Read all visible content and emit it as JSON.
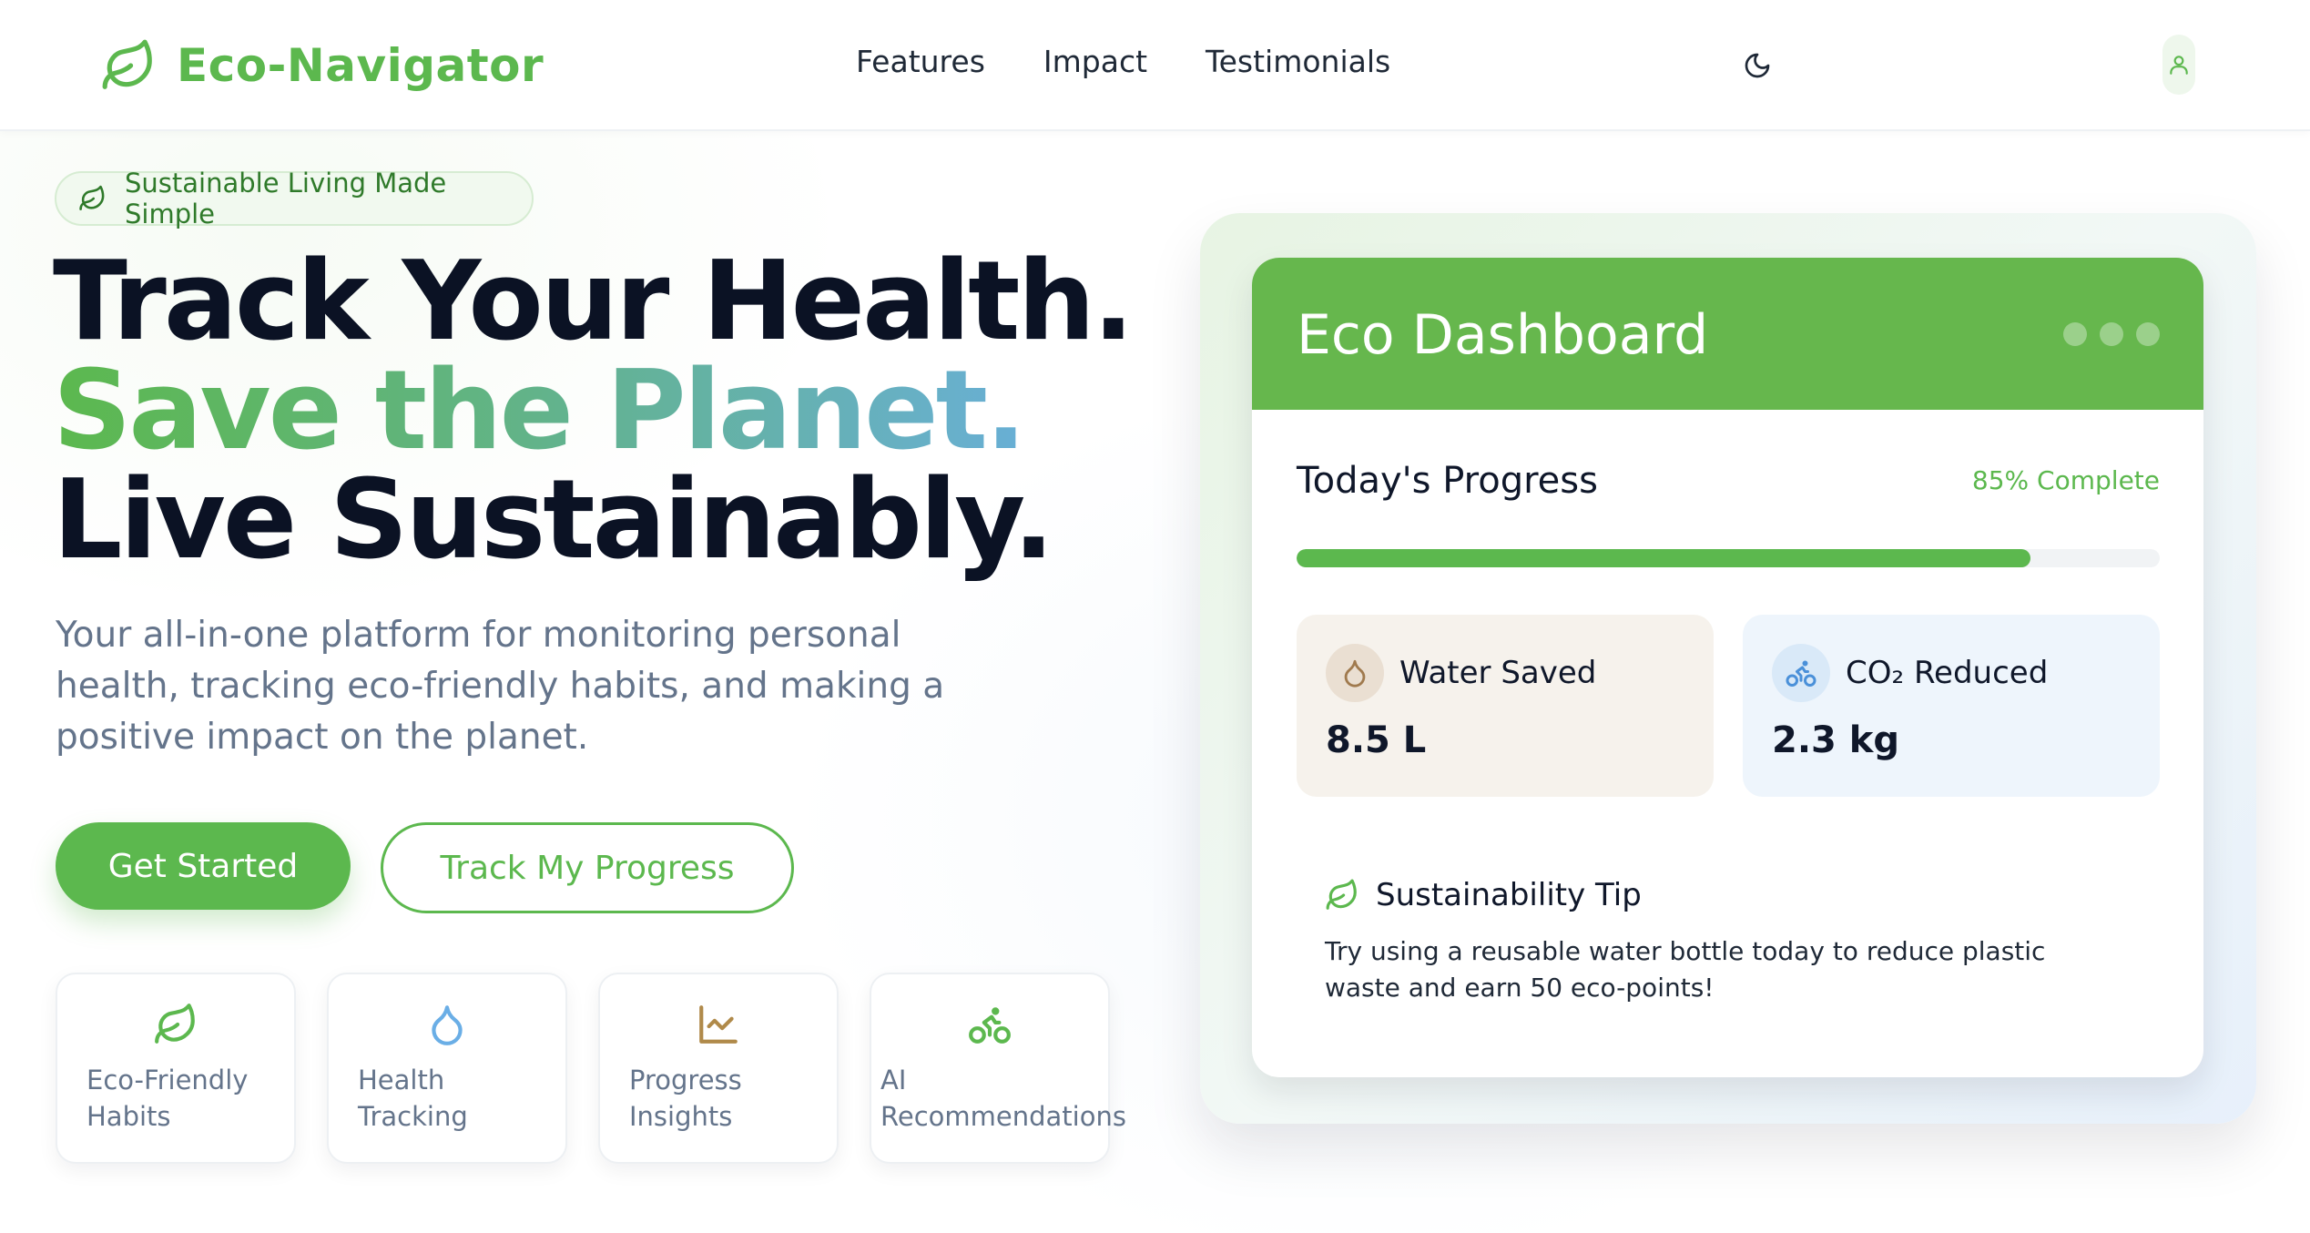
{
  "brand": {
    "name": "Eco-Navigator",
    "color": "#5cb84e"
  },
  "nav": {
    "links": [
      "Features",
      "Impact",
      "Testimonials"
    ],
    "theme_icon": "moon-icon",
    "user_icon": "user-icon"
  },
  "hero": {
    "badge": "Sustainable Living Made Simple",
    "headline": {
      "line1": "Track Your Health.",
      "line2": "Save the Planet.",
      "line3": "Live Sustainably."
    },
    "subtext": "Your all-in-one platform for monitoring personal health, tracking eco-friendly habits, and making a positive impact on the planet.",
    "primary_cta": "Get Started",
    "secondary_cta": "Track My Progress"
  },
  "features": [
    {
      "label": "Eco-Friendly Habits",
      "icon": "leaf-icon"
    },
    {
      "label": "Health Tracking",
      "icon": "droplet-icon"
    },
    {
      "label": "Progress Insights",
      "icon": "line-chart-icon"
    },
    {
      "label": "AI Recommendations",
      "icon": "bike-icon"
    }
  ],
  "dashboard": {
    "title": "Eco Dashboard",
    "progress": {
      "title": "Today's Progress",
      "status": "85% Complete",
      "value": 0.85
    },
    "stats": {
      "water": {
        "label": "Water Saved",
        "value": "8.5 L",
        "icon": "droplet-icon"
      },
      "co2": {
        "label": "CO₂ Reduced",
        "value": "2.3 kg",
        "icon": "bike-icon"
      }
    },
    "tip": {
      "title": "Sustainability Tip",
      "text": "Try using a reusable water bottle today to reduce plastic waste and earn 50 eco-points!"
    }
  },
  "colors": {
    "primary": "#5cb84e",
    "header_green": "#66b74d",
    "water_bg": "#f6f2ec",
    "co2_bg": "#eef5fc",
    "water_accent": "#a07a4e",
    "co2_accent": "#4a90d9"
  }
}
